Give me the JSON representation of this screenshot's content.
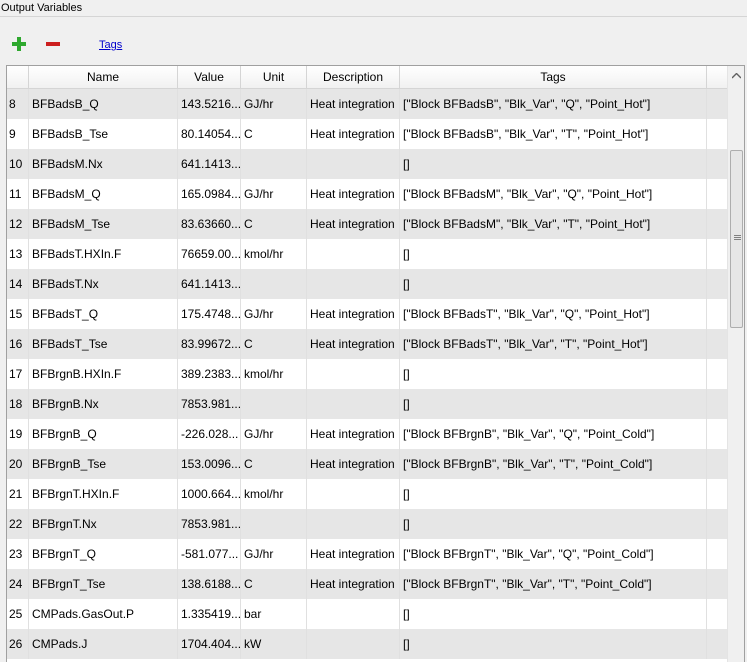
{
  "panel": {
    "title": "Output Variables"
  },
  "toolbar": {
    "tags_link": "Tags"
  },
  "icons": {
    "add": "plus-icon",
    "remove": "minus-icon",
    "scroll_up": "chevron-up-icon"
  },
  "colors": {
    "add_green": "#2ea82e",
    "remove_red": "#cc1f1f",
    "alt_row": "#e6e6e6"
  },
  "table": {
    "headers": {
      "name": "Name",
      "value": "Value",
      "unit": "Unit",
      "description": "Description",
      "tags": "Tags"
    },
    "rows": [
      {
        "idx": "8",
        "name": "BFBadsB_Q",
        "value": "143.5216...",
        "unit": "GJ/hr",
        "desc": "Heat integration",
        "tags": "[\"Block BFBadsB\", \"Blk_Var\", \"Q\", \"Point_Hot\"]"
      },
      {
        "idx": "9",
        "name": "BFBadsB_Tse",
        "value": "80.14054...",
        "unit": "C",
        "desc": "Heat integration",
        "tags": "[\"Block BFBadsB\", \"Blk_Var\", \"T\", \"Point_Hot\"]"
      },
      {
        "idx": "10",
        "name": "BFBadsM.Nx",
        "value": "641.1413...",
        "unit": "",
        "desc": "",
        "tags": "[]"
      },
      {
        "idx": "11",
        "name": "BFBadsM_Q",
        "value": "165.0984...",
        "unit": "GJ/hr",
        "desc": "Heat integration",
        "tags": "[\"Block BFBadsM\", \"Blk_Var\", \"Q\", \"Point_Hot\"]"
      },
      {
        "idx": "12",
        "name": "BFBadsM_Tse",
        "value": "83.63660...",
        "unit": "C",
        "desc": "Heat integration",
        "tags": "[\"Block BFBadsM\", \"Blk_Var\", \"T\", \"Point_Hot\"]"
      },
      {
        "idx": "13",
        "name": "BFBadsT.HXIn.F",
        "value": "76659.00...",
        "unit": "kmol/hr",
        "desc": "",
        "tags": "[]"
      },
      {
        "idx": "14",
        "name": "BFBadsT.Nx",
        "value": "641.1413...",
        "unit": "",
        "desc": "",
        "tags": "[]"
      },
      {
        "idx": "15",
        "name": "BFBadsT_Q",
        "value": "175.4748...",
        "unit": "GJ/hr",
        "desc": "Heat integration",
        "tags": "[\"Block BFBadsT\", \"Blk_Var\", \"Q\", \"Point_Hot\"]"
      },
      {
        "idx": "16",
        "name": "BFBadsT_Tse",
        "value": "83.99672...",
        "unit": "C",
        "desc": "Heat integration",
        "tags": "[\"Block BFBadsT\", \"Blk_Var\", \"T\", \"Point_Hot\"]"
      },
      {
        "idx": "17",
        "name": "BFBrgnB.HXIn.F",
        "value": "389.2383...",
        "unit": "kmol/hr",
        "desc": "",
        "tags": "[]"
      },
      {
        "idx": "18",
        "name": "BFBrgnB.Nx",
        "value": "7853.981...",
        "unit": "",
        "desc": "",
        "tags": "[]"
      },
      {
        "idx": "19",
        "name": "BFBrgnB_Q",
        "value": "-226.028...",
        "unit": "GJ/hr",
        "desc": "Heat integration",
        "tags": "[\"Block BFBrgnB\", \"Blk_Var\", \"Q\", \"Point_Cold\"]"
      },
      {
        "idx": "20",
        "name": "BFBrgnB_Tse",
        "value": "153.0096...",
        "unit": "C",
        "desc": "Heat integration",
        "tags": "[\"Block BFBrgnB\", \"Blk_Var\", \"T\", \"Point_Cold\"]"
      },
      {
        "idx": "21",
        "name": "BFBrgnT.HXIn.F",
        "value": "1000.664...",
        "unit": "kmol/hr",
        "desc": "",
        "tags": "[]"
      },
      {
        "idx": "22",
        "name": "BFBrgnT.Nx",
        "value": "7853.981...",
        "unit": "",
        "desc": "",
        "tags": "[]"
      },
      {
        "idx": "23",
        "name": "BFBrgnT_Q",
        "value": "-581.077...",
        "unit": "GJ/hr",
        "desc": "Heat integration",
        "tags": "[\"Block BFBrgnT\", \"Blk_Var\", \"Q\", \"Point_Cold\"]"
      },
      {
        "idx": "24",
        "name": "BFBrgnT_Tse",
        "value": "138.6188...",
        "unit": "C",
        "desc": "Heat integration",
        "tags": "[\"Block BFBrgnT\", \"Blk_Var\", \"T\", \"Point_Cold\"]"
      },
      {
        "idx": "25",
        "name": "CMPads.GasOut.P",
        "value": "1.335419...",
        "unit": "bar",
        "desc": "",
        "tags": "[]"
      },
      {
        "idx": "26",
        "name": "CMPads.J",
        "value": "1704.404...",
        "unit": "kW",
        "desc": "",
        "tags": "[]"
      }
    ]
  }
}
